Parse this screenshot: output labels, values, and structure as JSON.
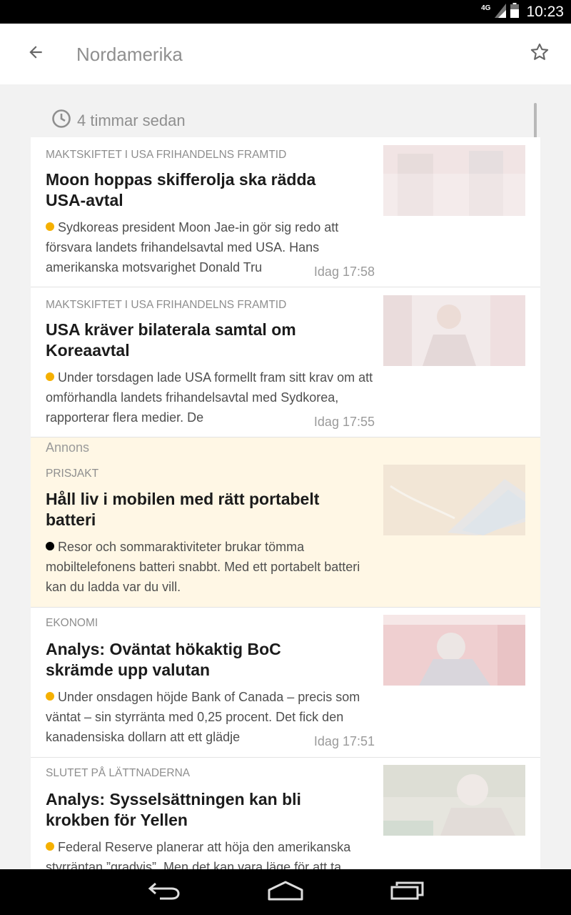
{
  "status_bar": {
    "network": "4G",
    "time": "10:23",
    "icons": [
      "signal-icon",
      "battery-icon"
    ]
  },
  "app_bar": {
    "title": "Nordamerika",
    "back_icon": "arrow-back-icon",
    "favorite_icon": "star-outline-icon"
  },
  "feed": {
    "time_header": "4 timmar sedan",
    "articles": [
      {
        "kicker": "MAKTSKIFTET I USA FRIHANDELNS FRAMTID",
        "headline": "Moon hoppas skifferolja ska rädda USA-avtal",
        "lead": "Sydkoreas president Moon Jae-in gör sig redo att försvara landets frihandelsavtal med USA. Hans amerikanska motsvarighet Donald Tru",
        "timestamp": "Idag 17:58",
        "dot_color": "#f5b000"
      },
      {
        "kicker": "MAKTSKIFTET I USA FRIHANDELNS FRAMTID",
        "headline": "USA kräver bilaterala samtal om Koreaavtal",
        "lead": "Under torsdagen lade USA formellt fram sitt krav om att omförhandla landets frihandelsavtal med Sydkorea, rapporterar flera medier. De",
        "timestamp": "Idag 17:55",
        "dot_color": "#f5b000"
      },
      {
        "ad_label": "Annons",
        "kicker": "PRISJAKT",
        "headline": "Håll liv i mobilen med rätt portabelt batteri",
        "lead": "Resor och sommaraktiviteter brukar tömma mobiltelefonens batteri snabbt. Med ett portabelt batteri kan du ladda var du vill.",
        "dot_color": "#000000"
      },
      {
        "kicker": "EKONOMI",
        "headline": "Analys: Oväntat hökaktig BoC skrämde upp valutan",
        "lead": "Under onsdagen höjde Bank of Canada – precis som väntat – sin styrränta med 0,25 procent. Det fick den kanadensiska dollarn att ett glädje",
        "timestamp": "Idag 17:51",
        "dot_color": "#f5b000"
      },
      {
        "kicker": "SLUTET PÅ LÄTTNADERNA",
        "headline": "Analys: Sysselsättningen kan bli krokben för Yellen",
        "lead": "Federal Reserve planerar att höja den amerikanska styrräntan ”gradvis”. Men det kan vara läge för att ta",
        "dot_color": "#f5b000"
      }
    ]
  },
  "nav_bar": {
    "icons": [
      "back-nav-icon",
      "home-nav-icon",
      "recents-nav-icon"
    ]
  }
}
